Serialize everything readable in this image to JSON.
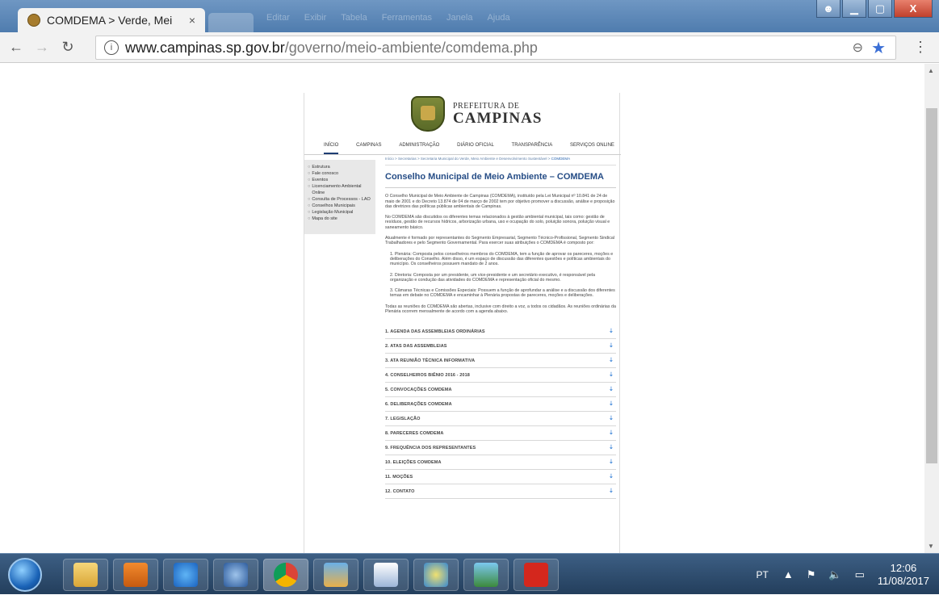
{
  "browser": {
    "tab_title": "COMDEMA > Verde, Mei",
    "tab_close": "×",
    "background_menu": [
      "Editar",
      "Exibir",
      "Tabela",
      "Ferramentas",
      "Janela",
      "Ajuda"
    ],
    "url_host": "www.campinas.sp.gov.br",
    "url_path": "/governo/meio-ambiente/comdema.php",
    "info_icon": "i",
    "window_close": "X"
  },
  "site": {
    "logo_line1": "PREFEITURA DE",
    "logo_line2": "CAMPINAS",
    "nav": [
      "INÍCIO",
      "CAMPINAS",
      "ADMINISTRAÇÃO",
      "DIÁRIO OFICIAL",
      "TRANSPARÊNCIA",
      "SERVIÇOS ONLINE"
    ],
    "sidebar": [
      "Estrutura",
      "Fale conosco",
      "Eventos",
      "Licenciamento Ambiental Online",
      "Consulta de Processos - LAO",
      "Conselhos Municipais",
      "Legislação Municipal",
      "Mapa do site"
    ],
    "breadcrumb": {
      "items": [
        "Início",
        "Secretarias",
        "Secretaria Municipal do Verde, Meio Ambiente e Desenvolvimento Sustentável"
      ],
      "separator": ">",
      "current": "COMDEMA"
    },
    "page_title": "Conselho Municipal de Meio Ambiente – COMDEMA",
    "paragraphs": {
      "p1": "O Conselho Municipal de Meio Ambiente de Campinas (COMDEMA), instituído pela Lei Municipal nº 10.841 de 24 de maio de 2001 e do Decreto 13.874 de 04 de março de 2002 tem por objetivo promover a discussão, análise e proposição das diretrizes das políticas públicas ambientais de Campinas.",
      "p2": "No COMDEMA são discutidos os diferentes temas relacionados à gestão ambiental municipal, tais como: gestão de resíduos, gestão de recursos hídricos, arborização urbana, uso e ocupação do solo, poluição sonora, poluição visual e saneamento básico.",
      "p3": "Atualmente é formado por representantes do Segmento Empresarial, Segmento Técnico-Profissional, Segmento Sindical Trabalhadores e pelo Segmento Governamental. Para exercer suas atribuições o COMDEMA é composto por:",
      "p4": "1. Plenária: Composta pelos conselheiros membros do COMDEMA, tem a função de aprovar os pareceres, moções e deliberações do Conselho. Além disso, é um espaço de discussão das diferentes questões e políticas ambientais do município. Os conselheiros possuem mandato de 2 anos.",
      "p5": "2. Diretoria: Composta por um presidente, um vice-presidente e um secretário executivo, é responsável pela organização e condução das atividades do COMDEMA e representação oficial do mesmo.",
      "p6": "3. Câmaras Técnicas e Comissões Especiais: Possuem a função de aprofundar a análise e a discussão dos diferentes temas em debate no COMDEMA e encaminhar à Plenária propostas de pareceres, moções e deliberações.",
      "p7": "Todas as reuniões do COMDEMA são abertas, inclusive com direito a voz, a todos os cidadãos. As reuniões ordinárias da Plenária ocorrem mensalmente de acordo com a agenda abaixo."
    },
    "accordion": [
      "1. AGENDA DAS ASSEMBLEIAS ORDINÁRIAS",
      "2. ATAS DAS ASSEMBLEIAS",
      "3. ATA REUNIÃO TÉCNICA INFORMATIVA",
      "4. CONSELHEIROS BIÊNIO 2016 - 2018",
      "5. CONVOCAÇÕES COMDEMA",
      "6. DELIBERAÇÕES COMDEMA",
      "7. LEGISLAÇÃO",
      "8. PARECERES COMDEMA",
      "9. FREQUÊNCIA DOS REPRESENTANTES",
      "10. ELEIÇÕES COMDEMA",
      "11. MOÇÕES",
      "12. CONTATO"
    ]
  },
  "taskbar": {
    "language": "PT",
    "time": "12:06",
    "date": "11/08/2017"
  },
  "colors": {
    "title_blue": "#264d86",
    "link_blue": "#2a66b0",
    "accordion_arrow": "#3f86d8",
    "star": "#3b6fd6"
  }
}
